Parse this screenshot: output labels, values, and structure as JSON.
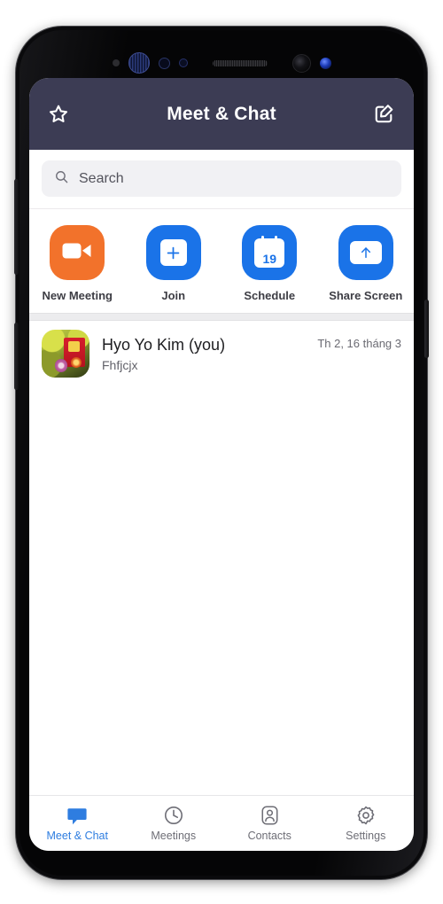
{
  "colors": {
    "header_bg": "#3c3c54",
    "accent_blue": "#2e7de0",
    "tile_blue": "#1a73e8",
    "tile_orange": "#f2722b",
    "screen_bg": "#ffffff",
    "search_bg": "#f1f1f4",
    "separator": "#ececee",
    "muted_text": "#6e6e76"
  },
  "device": {
    "sensors": [
      {
        "name": "proximity-sensor"
      },
      {
        "name": "iris-scanner"
      },
      {
        "name": "ambient-light-sensor"
      },
      {
        "name": "secondary-sensor"
      },
      {
        "name": "earpiece-speaker"
      },
      {
        "name": "front-camera"
      },
      {
        "name": "notification-led"
      }
    ],
    "buttons": [
      {
        "name": "volume-rocker"
      },
      {
        "name": "bixby-button"
      },
      {
        "name": "power-button"
      }
    ]
  },
  "header": {
    "title": "Meet & Chat",
    "left_icon": "star-icon",
    "right_icon": "compose-icon"
  },
  "search": {
    "icon": "search-icon",
    "placeholder": "Search",
    "value": ""
  },
  "actions": [
    {
      "id": "new-meeting",
      "label": "New Meeting",
      "icon": "video-camera-icon",
      "color": "#f2722b"
    },
    {
      "id": "join",
      "label": "Join",
      "icon": "plus-icon",
      "color": "#1a73e8"
    },
    {
      "id": "schedule",
      "label": "Schedule",
      "icon": "calendar-icon",
      "color": "#1a73e8",
      "calendar_day": "19"
    },
    {
      "id": "share-screen",
      "label": "Share Screen",
      "icon": "arrow-up-icon",
      "color": "#1a73e8"
    }
  ],
  "chats": [
    {
      "name": "Hyo Yo Kim (you)",
      "preview": "Fhfjcjx",
      "time": "Th 2, 16 tháng 3",
      "avatar": "photo-avatar"
    }
  ],
  "bottom_nav": {
    "active_index": 0,
    "items": [
      {
        "label": "Meet & Chat",
        "icon": "chat-bubble-icon"
      },
      {
        "label": "Meetings",
        "icon": "clock-icon"
      },
      {
        "label": "Contacts",
        "icon": "person-icon"
      },
      {
        "label": "Settings",
        "icon": "gear-icon"
      }
    ]
  }
}
